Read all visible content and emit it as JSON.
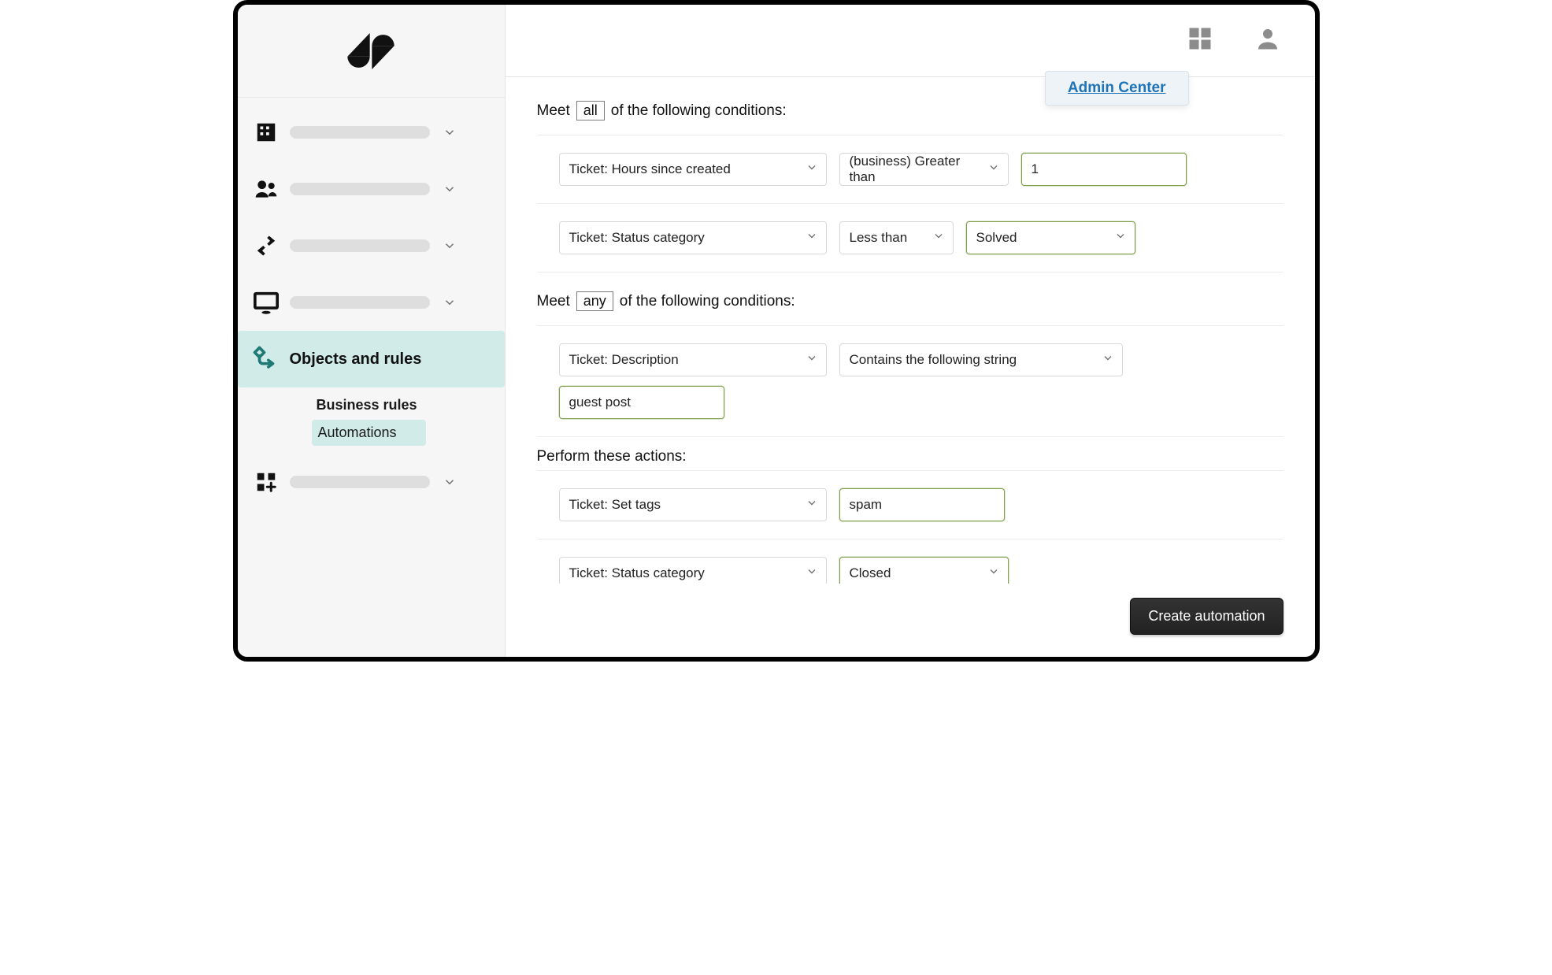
{
  "header": {
    "admin_center_label": "Admin Center"
  },
  "sidebar": {
    "active_label": "Objects and rules",
    "sub_heading": "Business rules",
    "sub_current": "Automations"
  },
  "conditions": {
    "meet_a": "Meet",
    "all_word": "all",
    "tail_a": "of the following conditions:",
    "meet_b": "Meet",
    "any_word": "any",
    "tail_b": "of the following conditions:",
    "row1": {
      "field": "Ticket: Hours since created",
      "op": "(business) Greater than",
      "value": "1"
    },
    "row2": {
      "field": "Ticket: Status category",
      "op": "Less than",
      "value": "Solved"
    },
    "row3": {
      "field": "Ticket: Description",
      "op": "Contains the following string",
      "value": "guest post"
    }
  },
  "actions": {
    "title": "Perform these actions:",
    "row1": {
      "field": "Ticket: Set tags",
      "value": "spam"
    },
    "row2": {
      "field": "Ticket: Status category",
      "value": "Closed"
    }
  },
  "buttons": {
    "create": "Create automation"
  }
}
